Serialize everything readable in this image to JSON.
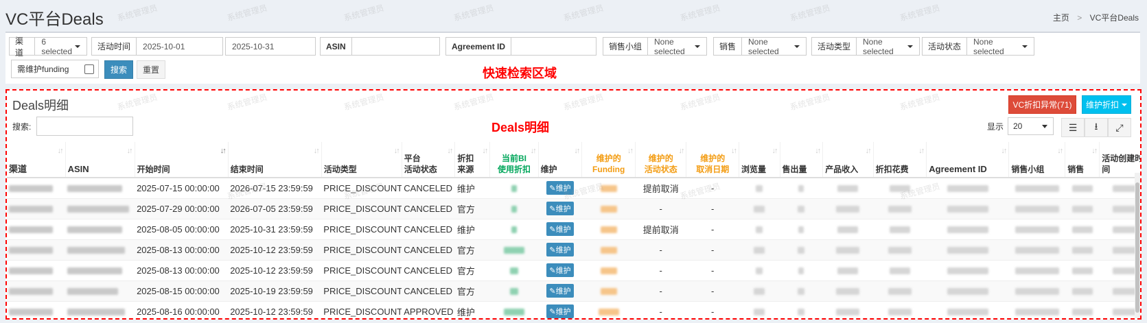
{
  "header": {
    "title": "VC平台Deals",
    "breadcrumb": [
      "主页",
      "VC平台Deals"
    ],
    "watermark": "系统管理员"
  },
  "filters": {
    "channel_label": "渠道",
    "channel_value": "6 selected",
    "time_label": "活动时间",
    "start_date": "2025-10-01",
    "end_date": "2025-10-31",
    "asin_label": "ASIN",
    "asin_value": "",
    "agreement_label": "Agreement ID",
    "agreement_value": "",
    "sales_group_label": "销售小组",
    "sales_group_value": "None selected",
    "sales_label": "销售",
    "sales_value": "None selected",
    "activity_type_label": "活动类型",
    "activity_type_value": "None selected",
    "activity_status_label": "活动状态",
    "activity_status_value": "None selected",
    "funding_label": "需维护funding",
    "search_button": "搜索",
    "reset_button": "重置",
    "annotation": "快速检索区域"
  },
  "deals": {
    "title": "Deals明细",
    "annotation": "Deals明细",
    "anomaly_button": "VC折扣异常(71)",
    "maintain_button": "维护折扣",
    "search_label": "搜索:",
    "show_label": "显示",
    "page_size": "20",
    "columns": [
      {
        "l1": "",
        "l2": "渠道"
      },
      {
        "l1": "",
        "l2": "ASIN"
      },
      {
        "l1": "",
        "l2": "开始时间"
      },
      {
        "l1": "",
        "l2": "结束时间"
      },
      {
        "l1": "",
        "l2": "活动类型"
      },
      {
        "l1": "平台",
        "l2": "活动状态"
      },
      {
        "l1": "折扣",
        "l2": "来源"
      },
      {
        "l1": "当前BI",
        "l2": "使用折扣"
      },
      {
        "l1": "",
        "l2": "维护"
      },
      {
        "l1": "维护的",
        "l2": "Funding"
      },
      {
        "l1": "维护的",
        "l2": "活动状态"
      },
      {
        "l1": "维护的",
        "l2": "取消日期"
      },
      {
        "l1": "",
        "l2": "浏览量"
      },
      {
        "l1": "",
        "l2": "售出量"
      },
      {
        "l1": "",
        "l2": "产品收入"
      },
      {
        "l1": "",
        "l2": "折扣花费"
      },
      {
        "l1": "",
        "l2": "Agreement ID"
      },
      {
        "l1": "",
        "l2": "销售小组"
      },
      {
        "l1": "",
        "l2": "销售"
      },
      {
        "l1": "",
        "l2": "活动创建时间"
      }
    ],
    "maintain_label": "维护",
    "rows": [
      {
        "start": "2025-07-15 00:00:00",
        "end": "2026-07-15 23:59:59",
        "type": "PRICE_DISCOUNT",
        "status": "CANCELED",
        "source": "维护",
        "m_status": "提前取消",
        "m_cancel": "-"
      },
      {
        "start": "2025-07-29 00:00:00",
        "end": "2026-07-05 23:59:59",
        "type": "PRICE_DISCOUNT",
        "status": "CANCELED",
        "source": "官方",
        "m_status": "-",
        "m_cancel": "-"
      },
      {
        "start": "2025-08-05 00:00:00",
        "end": "2025-10-31 23:59:59",
        "type": "PRICE_DISCOUNT",
        "status": "CANCELED",
        "source": "维护",
        "m_status": "提前取消",
        "m_cancel": "-"
      },
      {
        "start": "2025-08-13 00:00:00",
        "end": "2025-10-12 23:59:59",
        "type": "PRICE_DISCOUNT",
        "status": "CANCELED",
        "source": "官方",
        "m_status": "-",
        "m_cancel": "-"
      },
      {
        "start": "2025-08-13 00:00:00",
        "end": "2025-10-12 23:59:59",
        "type": "PRICE_DISCOUNT",
        "status": "CANCELED",
        "source": "官方",
        "m_status": "-",
        "m_cancel": "-"
      },
      {
        "start": "2025-08-15 00:00:00",
        "end": "2025-10-19 23:59:59",
        "type": "PRICE_DISCOUNT",
        "status": "CANCELED",
        "source": "官方",
        "m_status": "-",
        "m_cancel": "-"
      },
      {
        "start": "2025-08-16 00:00:00",
        "end": "2025-10-12 23:59:59",
        "type": "PRICE_DISCOUNT",
        "status": "APPROVED",
        "source": "维护",
        "m_status": "-",
        "m_cancel": "-"
      }
    ]
  }
}
